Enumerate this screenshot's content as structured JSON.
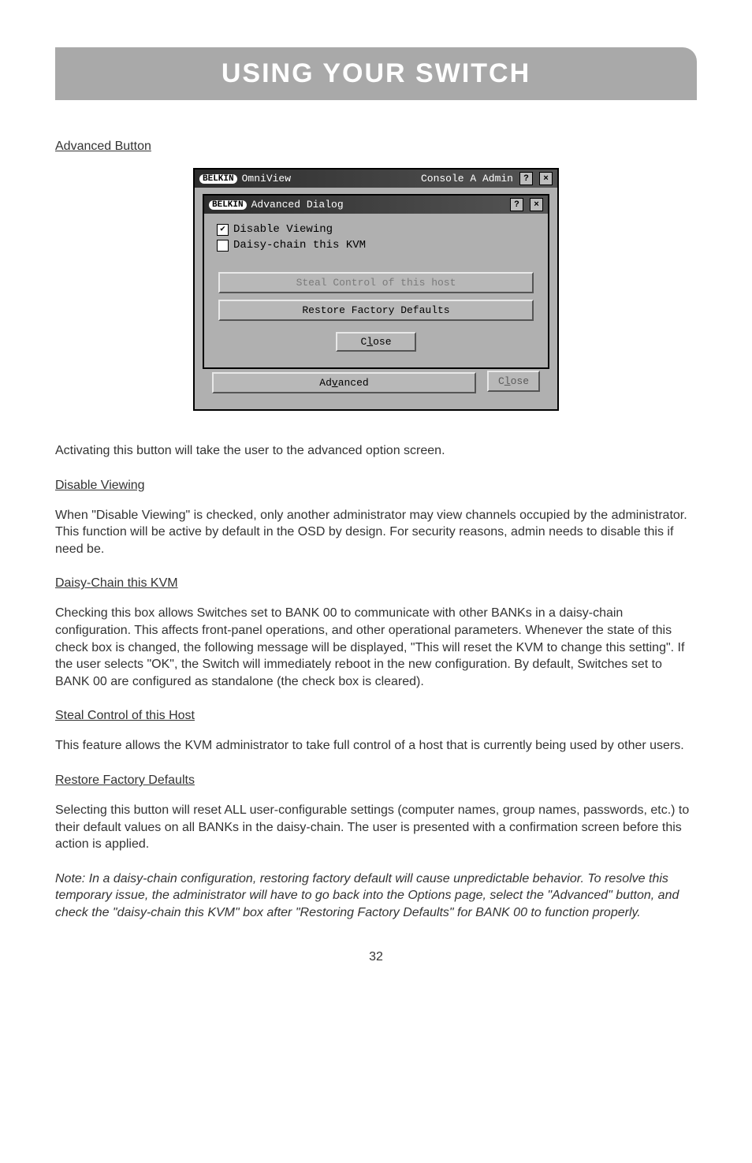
{
  "banner": {
    "title": "USING YOUR SWITCH"
  },
  "sections": {
    "advanced_button": {
      "heading": "Advanced Button"
    },
    "activating": {
      "text": "Activating this button will take the user to the advanced option screen."
    },
    "disable_viewing": {
      "heading": "Disable Viewing",
      "text": "When \"Disable Viewing\" is checked, only another administrator may view channels occupied by the administrator. This function will be active by default in the OSD by design. For security reasons, admin needs to disable this if need be."
    },
    "daisy_chain": {
      "heading": "Daisy-Chain this KVM",
      "text": "Checking this box allows Switches set to BANK 00 to communicate with other BANKs in a daisy-chain configuration. This affects front-panel operations, and other operational parameters. Whenever the state of this check box is changed, the following message will be displayed, \"This will reset the KVM to change this setting\". If the user selects \"OK\", the Switch will immediately reboot in the new configuration. By default, Switches set to BANK 00 are configured as standalone (the check box is cleared)."
    },
    "steal_control": {
      "heading": "Steal Control of this Host",
      "text": "This feature allows the KVM administrator to take full control of a host that is currently being used by other users."
    },
    "restore_defaults": {
      "heading": "Restore Factory Defaults",
      "text": "Selecting this button will reset ALL user-configurable settings (computer names, group names, passwords, etc.) to their default values on all BANKs in the daisy-chain. The user is presented with a confirmation screen before this action is applied."
    },
    "note": {
      "text": "Note: In a daisy-chain configuration, restoring factory default will cause unpredictable behavior. To resolve this temporary issue, the administrator will have to go back into the Options page, select the \"Advanced\" button, and check the \"daisy-chain this KVM\" box after \"Restoring Factory Defaults\" for BANK 00 to function properly."
    }
  },
  "screenshot": {
    "outer": {
      "logo": "BELKIN",
      "app": "OmniView",
      "context": "Console A Admin",
      "help": "?",
      "close": "×"
    },
    "inner": {
      "logo": "BELKIN",
      "title": "Advanced Dialog",
      "help": "?",
      "close": "×",
      "check1": {
        "label": "Disable Viewing",
        "checked": true
      },
      "check2": {
        "label": "Daisy-chain this KVM",
        "checked": false
      },
      "btn_steal": "Steal Control of this host",
      "btn_restore": "Restore Factory Defaults",
      "btn_close_pre": "C",
      "btn_close_u": "l",
      "btn_close_post": "ose"
    },
    "bottom": {
      "adv_pre": "Ad",
      "adv_u": "v",
      "adv_post": "anced",
      "close_pre": "C",
      "close_u": "l",
      "close_post": "ose"
    }
  },
  "page_number": "32"
}
